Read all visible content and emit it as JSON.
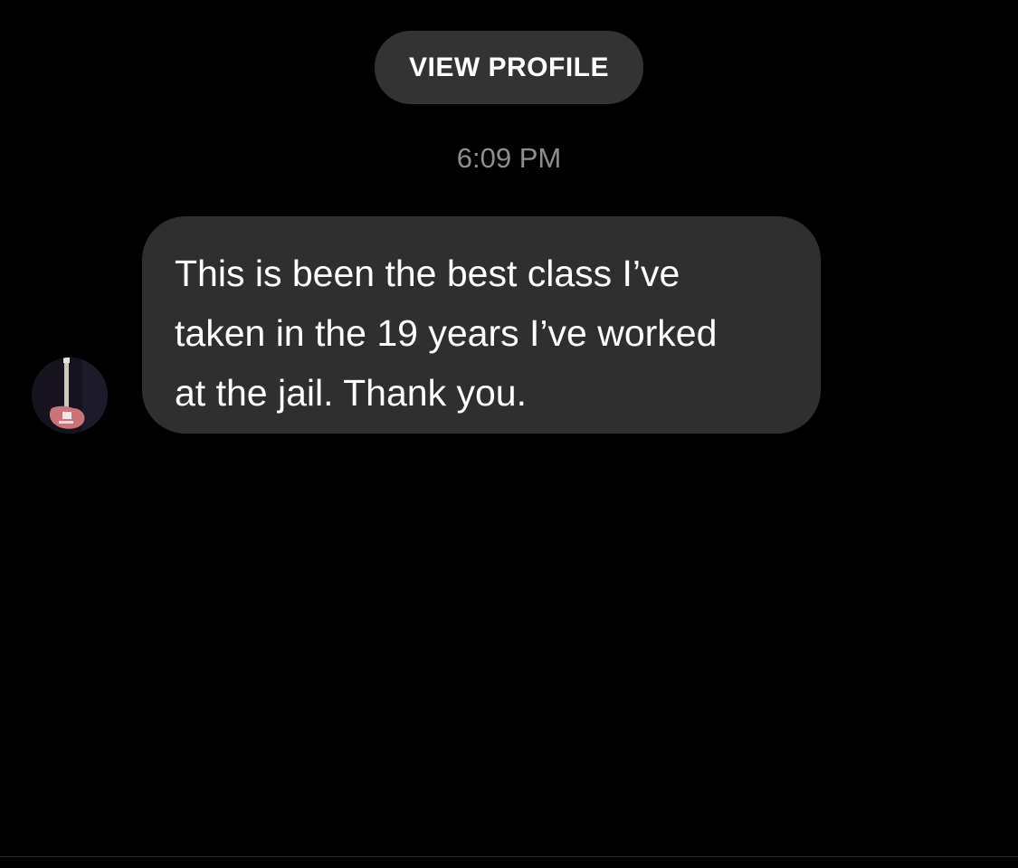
{
  "header": {
    "view_profile_label": "VIEW PROFILE"
  },
  "thread": {
    "timestamp": "6:09 PM",
    "messages": [
      {
        "sender": "other",
        "text": "This is been the best class I’ve\ntaken in the 19 years I’ve worked\nat the jail. Thank you."
      }
    ]
  },
  "colors": {
    "background": "#000000",
    "bubble": "#2f2f2f",
    "button": "#333333",
    "timestamp": "#8e8e8e",
    "text": "#ffffff"
  },
  "icons": {
    "avatar": "guitar-avatar-icon"
  }
}
